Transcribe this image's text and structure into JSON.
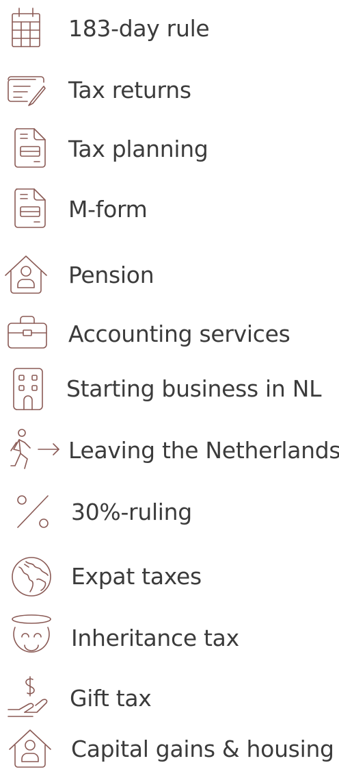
{
  "menu": {
    "items": [
      {
        "label": "183-day rule",
        "icon": "calendar-icon"
      },
      {
        "label": "Tax returns",
        "icon": "form-pen-icon"
      },
      {
        "label": "Tax planning",
        "icon": "document-icon"
      },
      {
        "label": "M-form",
        "icon": "document-icon"
      },
      {
        "label": "Pension",
        "icon": "house-person-icon"
      },
      {
        "label": "Accounting services",
        "icon": "briefcase-icon"
      },
      {
        "label": "Starting business in NL",
        "icon": "building-icon"
      },
      {
        "label": "Leaving the Netherlands",
        "icon": "walking-arrow-icon"
      },
      {
        "label": "30%-ruling",
        "icon": "percent-icon"
      },
      {
        "label": "Expat taxes",
        "icon": "globe-icon"
      },
      {
        "label": "Inheritance tax",
        "icon": "halo-face-icon"
      },
      {
        "label": "Gift tax",
        "icon": "dollar-hand-icon"
      },
      {
        "label": "Capital gains & housing",
        "icon": "house-person-icon"
      }
    ]
  },
  "colors": {
    "icon_stroke": "#8a5a55",
    "label_text": "#3b3b3b",
    "background": "#ffffff"
  }
}
